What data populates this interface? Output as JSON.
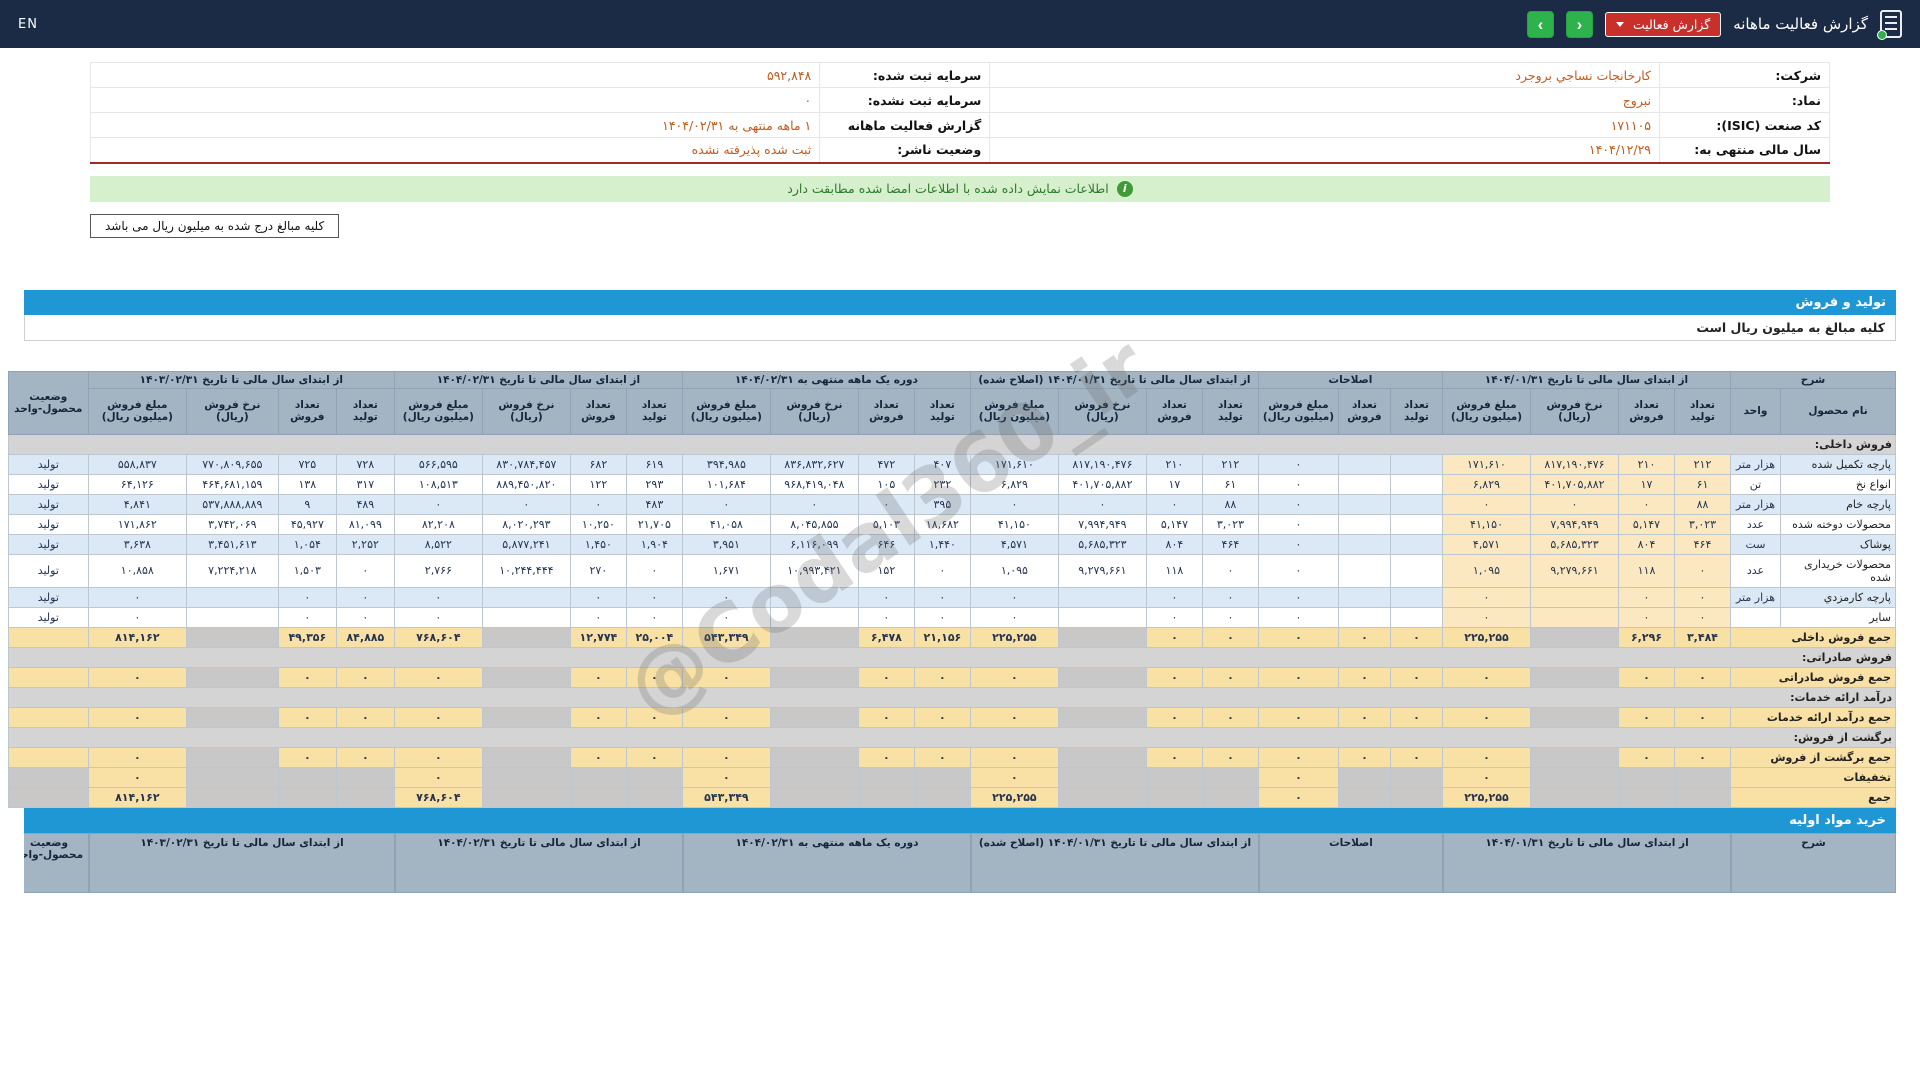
{
  "topbar": {
    "title": "گزارش فعالیت ماهانه",
    "report_select": "گزارش فعالیت",
    "en": "EN",
    "prev": "‹",
    "next": "›"
  },
  "info": {
    "rows": [
      {
        "r_label": "شرکت:",
        "r_value": "کارخانجات نساجي بروجرد",
        "l_label": "سرمایه ثبت شده:",
        "l_value": "۵۹۲,۸۴۸"
      },
      {
        "r_label": "نماد:",
        "r_value": "نبروج",
        "l_label": "سرمایه ثبت نشده:",
        "l_value": "۰"
      },
      {
        "r_label": "کد صنعت (ISIC):",
        "r_value": "۱۷۱۱۰۵",
        "l_label": "گزارش فعالیت ماهانه",
        "l_value": "۱ ماهه منتهی به ۱۴۰۴/۰۲/۳۱"
      },
      {
        "r_label": "سال مالی منتهی به:",
        "r_value": "۱۴۰۴/۱۲/۲۹",
        "l_label": "وضعیت ناشر:",
        "l_value": "ثبت شده پذیرفته نشده"
      }
    ]
  },
  "banner": {
    "text": "اطلاعات نمایش داده شده با اطلاعات امضا شده مطابقت دارد",
    "icon": "i"
  },
  "note": "کلیه مبالغ درج شده به میلیون ریال می باشد",
  "section": {
    "title": "تولید و فروش",
    "subtitle": "کلیه مبالغ به میلیون ریال است"
  },
  "watermark": "@Codal360_ir",
  "table": {
    "desc_label": "شرح",
    "name_col": "نام محصول",
    "unit_col": "واحد",
    "status_col": "وضعیت محصول-واحد",
    "groups": [
      {
        "label": "از ابتدای سال مالی تا تاریخ ۱۴۰۴/۰۱/۳۱",
        "cols": [
          "تعداد تولید",
          "تعداد فروش",
          "نرخ فروش (ریال)",
          "مبلغ فروش (میلیون ریال)"
        ]
      },
      {
        "label": "اصلاحات",
        "cols": [
          "تعداد تولید",
          "تعداد فروش",
          "مبلغ فروش (میلیون ریال)"
        ]
      },
      {
        "label": "از ابتدای سال مالی تا تاریخ ۱۴۰۴/۰۱/۳۱ (اصلاح شده)",
        "cols": [
          "تعداد تولید",
          "تعداد فروش",
          "نرخ فروش (ریال)",
          "مبلغ فروش (میلیون ریال)"
        ]
      },
      {
        "label": "دوره یک ماهه منتهی به ۱۴۰۴/۰۲/۳۱",
        "cols": [
          "تعداد تولید",
          "تعداد فروش",
          "نرخ فروش (ریال)",
          "مبلغ فروش (میلیون ریال)"
        ]
      },
      {
        "label": "از ابتدای سال مالی تا تاریخ ۱۴۰۴/۰۲/۳۱",
        "cols": [
          "تعداد تولید",
          "تعداد فروش",
          "نرخ فروش (ریال)",
          "مبلغ فروش (میلیون ریال)"
        ]
      },
      {
        "label": "از ابتدای سال مالی تا تاریخ ۱۴۰۳/۰۲/۳۱",
        "cols": [
          "تعداد تولید",
          "تعداد فروش",
          "نرخ فروش (ریال)",
          "مبلغ فروش (میلیون ریال)"
        ]
      }
    ],
    "rows": [
      {
        "type": "section",
        "label": "فروش داخلی:"
      },
      {
        "type": "data",
        "name": "پارچه تکمیل شده",
        "unit": "هزار متر",
        "status": "تولید",
        "cells": [
          "۲۱۲",
          "۲۱۰",
          "۸۱۷,۱۹۰,۴۷۶",
          "۱۷۱,۶۱۰",
          "",
          "",
          "۰",
          "۲۱۲",
          "۲۱۰",
          "۸۱۷,۱۹۰,۴۷۶",
          "۱۷۱,۶۱۰",
          "۴۰۷",
          "۴۷۲",
          "۸۳۶,۸۳۲,۶۲۷",
          "۳۹۴,۹۸۵",
          "۶۱۹",
          "۶۸۲",
          "۸۳۰,۷۸۴,۴۵۷",
          "۵۶۶,۵۹۵",
          "۷۲۸",
          "۷۲۵",
          "۷۷۰,۸۰۹,۶۵۵",
          "۵۵۸,۸۳۷"
        ]
      },
      {
        "type": "data",
        "name": "انواع نخ",
        "unit": "تن",
        "status": "تولید",
        "cells": [
          "۶۱",
          "۱۷",
          "۴۰۱,۷۰۵,۸۸۲",
          "۶,۸۲۹",
          "",
          "",
          "۰",
          "۶۱",
          "۱۷",
          "۴۰۱,۷۰۵,۸۸۲",
          "۶,۸۲۹",
          "۲۳۲",
          "۱۰۵",
          "۹۶۸,۴۱۹,۰۴۸",
          "۱۰۱,۶۸۴",
          "۲۹۳",
          "۱۲۲",
          "۸۸۹,۴۵۰,۸۲۰",
          "۱۰۸,۵۱۳",
          "۳۱۷",
          "۱۳۸",
          "۴۶۴,۶۸۱,۱۵۹",
          "۶۴,۱۲۶"
        ]
      },
      {
        "type": "data",
        "name": "پارچه خام",
        "unit": "هزار متر",
        "status": "تولید",
        "cells": [
          "۸۸",
          "۰",
          "۰",
          "۰",
          "",
          "",
          "۰",
          "۸۸",
          "۰",
          "۰",
          "۰",
          "۳۹۵",
          "۰",
          "۰",
          "۰",
          "۴۸۳",
          "۰",
          "۰",
          "۰",
          "۴۸۹",
          "۹",
          "۵۳۷,۸۸۸,۸۸۹",
          "۴,۸۴۱"
        ]
      },
      {
        "type": "data",
        "name": "محصولات دوخته شده",
        "unit": "عدد",
        "status": "تولید",
        "cells": [
          "۳,۰۲۳",
          "۵,۱۴۷",
          "۷,۹۹۴,۹۴۹",
          "۴۱,۱۵۰",
          "",
          "",
          "۰",
          "۳,۰۲۳",
          "۵,۱۴۷",
          "۷,۹۹۴,۹۴۹",
          "۴۱,۱۵۰",
          "۱۸,۶۸۲",
          "۵,۱۰۳",
          "۸,۰۴۵,۸۵۵",
          "۴۱,۰۵۸",
          "۲۱,۷۰۵",
          "۱۰,۲۵۰",
          "۸,۰۲۰,۲۹۳",
          "۸۲,۲۰۸",
          "۸۱,۰۹۹",
          "۴۵,۹۲۷",
          "۳,۷۴۲,۰۶۹",
          "۱۷۱,۸۶۲"
        ]
      },
      {
        "type": "data",
        "name": "پوشاک",
        "unit": "ست",
        "status": "تولید",
        "cells": [
          "۴۶۴",
          "۸۰۴",
          "۵,۶۸۵,۳۲۳",
          "۴,۵۷۱",
          "",
          "",
          "۰",
          "۴۶۴",
          "۸۰۴",
          "۵,۶۸۵,۳۲۳",
          "۴,۵۷۱",
          "۱,۴۴۰",
          "۶۴۶",
          "۶,۱۱۶,۰۹۹",
          "۳,۹۵۱",
          "۱,۹۰۴",
          "۱,۴۵۰",
          "۵,۸۷۷,۲۴۱",
          "۸,۵۲۲",
          "۲,۲۵۲",
          "۱,۰۵۴",
          "۳,۴۵۱,۶۱۳",
          "۳,۶۳۸"
        ]
      },
      {
        "type": "data",
        "name": "محصولات خریداری شده",
        "unit": "عدد",
        "status": "تولید",
        "cells": [
          "۰",
          "۱۱۸",
          "۹,۲۷۹,۶۶۱",
          "۱,۰۹۵",
          "",
          "",
          "۰",
          "۰",
          "۱۱۸",
          "۹,۲۷۹,۶۶۱",
          "۱,۰۹۵",
          "۰",
          "۱۵۲",
          "۱۰,۹۹۳,۴۲۱",
          "۱,۶۷۱",
          "۰",
          "۲۷۰",
          "۱۰,۲۴۴,۴۴۴",
          "۲,۷۶۶",
          "۰",
          "۱,۵۰۳",
          "۷,۲۲۴,۲۱۸",
          "۱۰,۸۵۸"
        ]
      },
      {
        "type": "data",
        "name": "پارچه کارمزدي",
        "unit": "هزار متر",
        "status": "تولید",
        "cells": [
          "۰",
          "۰",
          "",
          "۰",
          "",
          "",
          "۰",
          "۰",
          "۰",
          "",
          "۰",
          "۰",
          "۰",
          "",
          "۰",
          "۰",
          "۰",
          "",
          "۰",
          "۰",
          "۰",
          "",
          "۰"
        ]
      },
      {
        "type": "data",
        "name": "سایر",
        "unit": "",
        "status": "تولید",
        "cells": [
          "۰",
          "۰",
          "",
          "۰",
          "",
          "",
          "۰",
          "۰",
          "۰",
          "",
          "۰",
          "۰",
          "۰",
          "",
          "۰",
          "۰",
          "۰",
          "",
          "۰",
          "۰",
          "۰",
          "",
          "۰"
        ]
      },
      {
        "type": "total",
        "label": "جمع فروش داخلی",
        "muted": "rates",
        "cells": [
          "۳,۴۸۴",
          "۶,۲۹۶",
          "",
          "۲۲۵,۲۵۵",
          "۰",
          "۰",
          "۰",
          "۰",
          "۰",
          "",
          "۲۲۵,۲۵۵",
          "۲۱,۱۵۶",
          "۶,۴۷۸",
          "",
          "۵۴۳,۳۴۹",
          "۲۵,۰۰۴",
          "۱۲,۷۷۴",
          "",
          "۷۶۸,۶۰۴",
          "۸۴,۸۸۵",
          "۴۹,۳۵۶",
          "",
          "۸۱۴,۱۶۲"
        ]
      },
      {
        "type": "section",
        "label": "فروش صادراتی:"
      },
      {
        "type": "total",
        "label": "جمع فروش صادراتی",
        "muted": "rates",
        "cells": [
          "۰",
          "۰",
          "",
          "۰",
          "۰",
          "۰",
          "۰",
          "۰",
          "۰",
          "",
          "۰",
          "۰",
          "۰",
          "",
          "۰",
          "۰",
          "۰",
          "",
          "۰",
          "۰",
          "۰",
          "",
          "۰"
        ]
      },
      {
        "type": "section",
        "label": "درآمد ارائه خدمات:"
      },
      {
        "type": "total",
        "label": "جمع درآمد ارائه خدمات",
        "muted": "rates",
        "cells": [
          "۰",
          "۰",
          "",
          "۰",
          "۰",
          "۰",
          "۰",
          "۰",
          "۰",
          "",
          "۰",
          "۰",
          "۰",
          "",
          "۰",
          "۰",
          "۰",
          "",
          "۰",
          "۰",
          "۰",
          "",
          "۰"
        ]
      },
      {
        "type": "section",
        "label": "برگشت از فروش:"
      },
      {
        "type": "total",
        "label": "جمع برگشت از فروش",
        "muted": "rates",
        "cells": [
          "۰",
          "۰",
          "",
          "۰",
          "۰",
          "۰",
          "۰",
          "۰",
          "۰",
          "",
          "۰",
          "۰",
          "۰",
          "",
          "۰",
          "۰",
          "۰",
          "",
          "۰",
          "۰",
          "۰",
          "",
          "۰"
        ]
      },
      {
        "type": "total",
        "label": "تخفیفات",
        "muted": "nonamount",
        "cells": [
          "",
          "",
          "",
          "۰",
          "",
          "",
          "۰",
          "",
          "",
          "",
          "۰",
          "",
          "",
          "",
          "۰",
          "",
          "",
          "",
          "۰",
          "",
          "",
          "",
          "۰"
        ]
      },
      {
        "type": "total",
        "label": "جمع",
        "muted": "nonamount",
        "cells": [
          "",
          "",
          "",
          "۲۲۵,۲۵۵",
          "",
          "",
          "۰",
          "",
          "",
          "",
          "۲۲۵,۲۵۵",
          "",
          "",
          "",
          "۵۴۳,۳۴۹",
          "",
          "",
          "",
          "۷۶۸,۶۰۴",
          "",
          "",
          "",
          "۸۱۴,۱۶۲"
        ]
      }
    ]
  },
  "purchase": {
    "title": "خرید مواد اولیه",
    "groups": [
      "شرح",
      "از ابتدای سال مالی تا تاریخ ۱۴۰۴/۰۱/۳۱",
      "اصلاحات",
      "از ابتدای سال مالی تا تاریخ ۱۴۰۴/۰۱/۳۱ (اصلاح شده)",
      "دوره یک ماهه منتهی به ۱۴۰۴/۰۲/۳۱",
      "از ابتدای سال مالی تا تاریخ ۱۴۰۴/۰۲/۳۱",
      "از ابتدای سال مالی تا تاریخ ۱۴۰۳/۰۲/۳۱",
      "وضعیت محصول-واحد"
    ]
  }
}
